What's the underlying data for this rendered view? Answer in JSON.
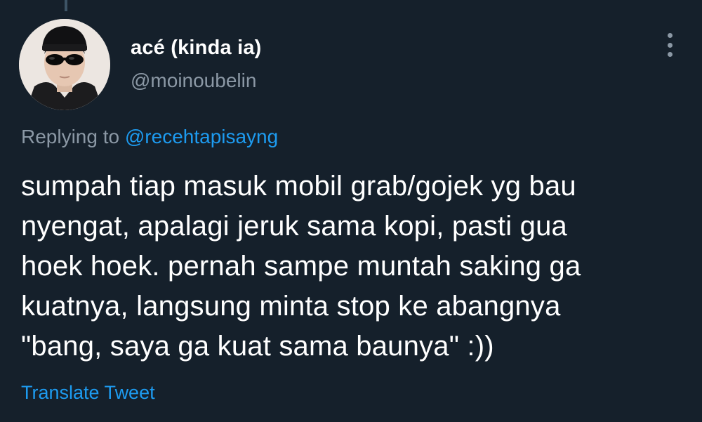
{
  "tweet": {
    "author": {
      "display_name": "acé (kinda ia)",
      "handle": "@moinoubelin"
    },
    "reply_context": {
      "prefix": "Replying to",
      "mention": "@recehtapisayng"
    },
    "text_lines": [
      "sumpah tiap masuk mobil grab/gojek yg bau",
      "nyengat, apalagi jeruk sama kopi, pasti gua",
      "hoek hoek. pernah sampe muntah saking ga",
      "kuatnya, langsung minta stop ke abangnya",
      "\"bang, saya ga kuat sama baunya\" :))"
    ],
    "translate_label": "Translate Tweet",
    "more_icon": "more-vertical-icon"
  },
  "colors": {
    "background": "#15202b",
    "primary_text": "#ffffff",
    "secondary_text": "#8b98a5",
    "accent": "#1d9bf0",
    "thread_line": "#3d5466"
  }
}
